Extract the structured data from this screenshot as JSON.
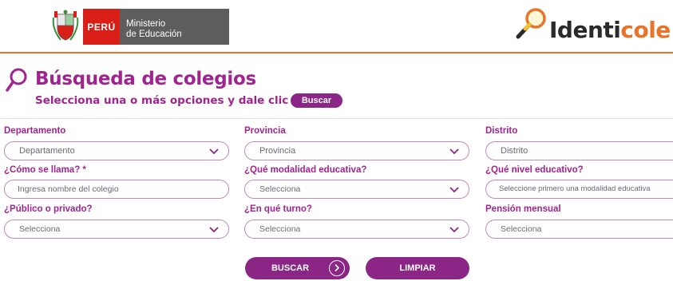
{
  "header": {
    "peru": "PERÚ",
    "ministry_line1": "Ministerio",
    "ministry_line2": "de Educación",
    "logo_part1": "Identi",
    "logo_part2": "cole"
  },
  "page": {
    "title": "Búsqueda de colegios",
    "subtitle": "Selecciona una o más opciones y dale clic en",
    "subtitle_button": "Buscar"
  },
  "form": {
    "departamento": {
      "label": "Departamento",
      "value": "Departamento"
    },
    "provincia": {
      "label": "Provincia",
      "value": "Provincia"
    },
    "distrito": {
      "label": "Distrito",
      "value": "Distrito"
    },
    "nombre": {
      "label": "¿Cómo se llama? *",
      "placeholder": "Ingresa nombre del colegio"
    },
    "modalidad": {
      "label": "¿Qué modalidad educativa?",
      "value": "Selecciona"
    },
    "nivel": {
      "label": "¿Qué nivel educativo?",
      "value": "Seleccione primero una modalidad educativa"
    },
    "gestion": {
      "label": "¿Público o privado?",
      "value": "Selecciona"
    },
    "turno": {
      "label": "¿En qué turno?",
      "value": "Selecciona"
    },
    "pension": {
      "label": "Pensión mensual",
      "value": "Selecciona"
    }
  },
  "buttons": {
    "buscar": "BUSCAR",
    "limpiar": "LIMPIAR"
  },
  "colors": {
    "purple": "#a0248f",
    "button_purple": "#8b2586",
    "orange": "#e8742a",
    "peru_red": "#d91e18"
  }
}
